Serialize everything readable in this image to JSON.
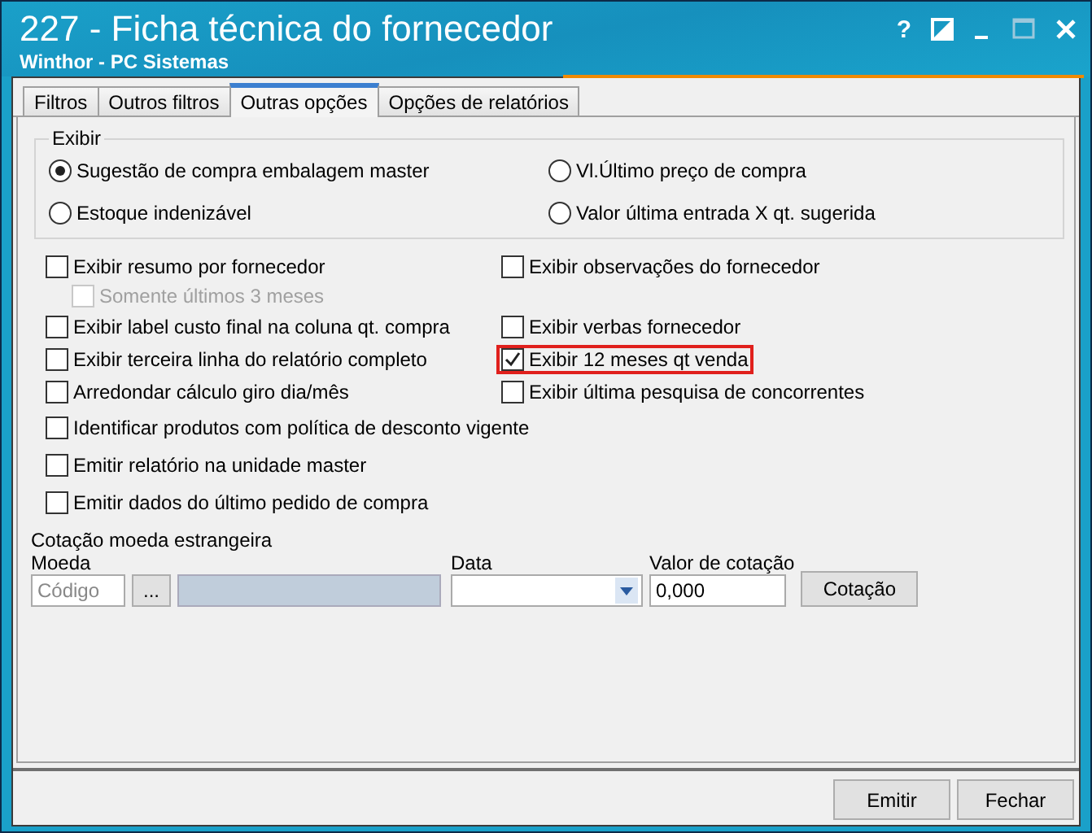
{
  "window": {
    "title": "227 - Ficha técnica do fornecedor",
    "subtitle": "Winthor - PC Sistemas",
    "help": "?"
  },
  "tabs": [
    {
      "label": "Filtros",
      "selected": false
    },
    {
      "label": "Outros filtros",
      "selected": false
    },
    {
      "label": "Outras opções",
      "selected": true
    },
    {
      "label": "Opções de relatórios",
      "selected": false
    }
  ],
  "exibir": {
    "title": "Exibir",
    "options": [
      {
        "label": "Sugestão de compra embalagem master",
        "selected": true
      },
      {
        "label": "Vl.Último preço de compra",
        "selected": false
      },
      {
        "label": "Estoque indenizável",
        "selected": false
      },
      {
        "label": "Valor última entrada X qt. sugerida",
        "selected": false
      }
    ]
  },
  "checkbox_rows": [
    {
      "left": {
        "label": "Exibir resumo por fornecedor",
        "checked": false,
        "disabled": false,
        "highlighted": false
      },
      "right": {
        "label": "Exibir observações do fornecedor",
        "checked": false,
        "disabled": false,
        "highlighted": false
      }
    },
    {
      "left": {
        "label": "Somente últimos 3 meses",
        "checked": false,
        "disabled": true,
        "highlighted": false,
        "indented": true
      }
    },
    {
      "left": {
        "label": "Exibir label custo final na coluna qt. compra",
        "checked": false,
        "disabled": false,
        "highlighted": false
      },
      "right": {
        "label": "Exibir verbas fornecedor",
        "checked": false,
        "disabled": false,
        "highlighted": false
      }
    },
    {
      "left": {
        "label": "Exibir terceira linha do relatório completo",
        "checked": false,
        "disabled": false,
        "highlighted": false
      },
      "right": {
        "label": "Exibir 12 meses qt venda",
        "checked": true,
        "disabled": false,
        "highlighted": true
      }
    },
    {
      "left": {
        "label": "Arredondar cálculo giro dia/mês",
        "checked": false,
        "disabled": false,
        "highlighted": false
      },
      "right": {
        "label": "Exibir última pesquisa de concorrentes",
        "checked": false,
        "disabled": false,
        "highlighted": false
      }
    },
    {
      "left": {
        "label": "Identificar produtos com política de desconto vigente",
        "checked": false,
        "disabled": false,
        "highlighted": false
      }
    },
    {
      "left": {
        "label": "Emitir relatório na unidade master",
        "checked": false,
        "disabled": false,
        "highlighted": false
      }
    },
    {
      "left": {
        "label": "Emitir dados do último pedido de compra",
        "checked": false,
        "disabled": false,
        "highlighted": false
      }
    }
  ],
  "cotacao": {
    "title": "Cotação moeda estrangeira",
    "moeda_label": "Moeda",
    "moeda_placeholder": "Código",
    "browse_button": "...",
    "data_label": "Data",
    "valor_label": "Valor de cotação",
    "valor": "0,000",
    "button": "Cotação"
  },
  "footer_buttons": [
    "Emitir",
    "Fechar"
  ]
}
